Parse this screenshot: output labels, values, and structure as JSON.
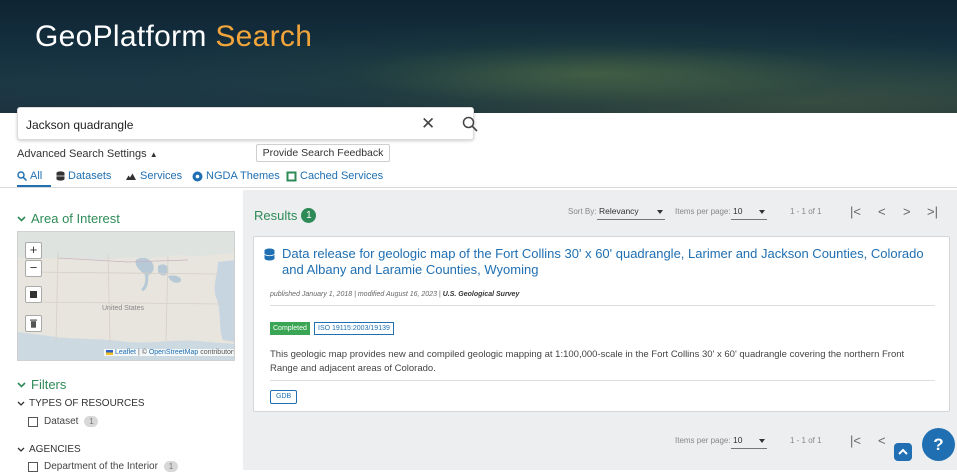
{
  "header": {
    "brand_main": "GeoPlatform",
    "brand_accent": "Search"
  },
  "search": {
    "query": "Jackson quadrangle",
    "placeholder": ""
  },
  "advanced_label": "Advanced Search Settings",
  "feedback_label": "Provide Search Feedback",
  "tabs": [
    {
      "label": "All",
      "icon": "search-icon"
    },
    {
      "label": "Datasets",
      "icon": "database-icon"
    },
    {
      "label": "Services",
      "icon": "cloud-icon"
    },
    {
      "label": "NGDA Themes",
      "icon": "gear-icon"
    },
    {
      "label": "Cached Services",
      "icon": "square-icon"
    }
  ],
  "aoi": {
    "title": "Area of Interest",
    "map_label": "United States",
    "attr_leaflet": "Leaflet",
    "attr_osm": "OpenStreetMap",
    "attr_suffix": "contributors"
  },
  "filters": {
    "title": "Filters",
    "facets": [
      {
        "title": "TYPES OF RESOURCES",
        "items": [
          {
            "label": "Dataset",
            "count": "1"
          }
        ]
      },
      {
        "title": "AGENCIES",
        "items": [
          {
            "label": "Department of the Interior",
            "count": "1"
          }
        ]
      }
    ]
  },
  "results": {
    "label": "Results",
    "count": "1",
    "sort_by_label": "Sort By:",
    "sort_by_value": "Relevancy",
    "items_per_page_label": "Items per page:",
    "items_per_page_value": "10",
    "range": "1 - 1 of 1"
  },
  "card": {
    "title": "Data release for geologic map of the Fort Collins 30' x 60' quadrangle, Larimer and Jackson Counties, Colorado and Albany and Laramie Counties, Wyoming",
    "meta_published": "published January 1, 2018",
    "meta_modified": "modified August 16, 2023",
    "meta_publisher": "U.S. Geological Survey",
    "status": "Completed",
    "standard": "ISO 19115:2003/19139",
    "description": "This geologic map provides new and compiled geologic mapping at 1:100,000-scale in the Fort Collins 30' x 60' quadrangle covering the northern Front Range and adjacent areas of Colorado.",
    "format": "GDB"
  },
  "help_label": "?",
  "colors": {
    "primary": "#1f6fb2",
    "green": "#2e8b57",
    "accent": "#f2a53a"
  }
}
